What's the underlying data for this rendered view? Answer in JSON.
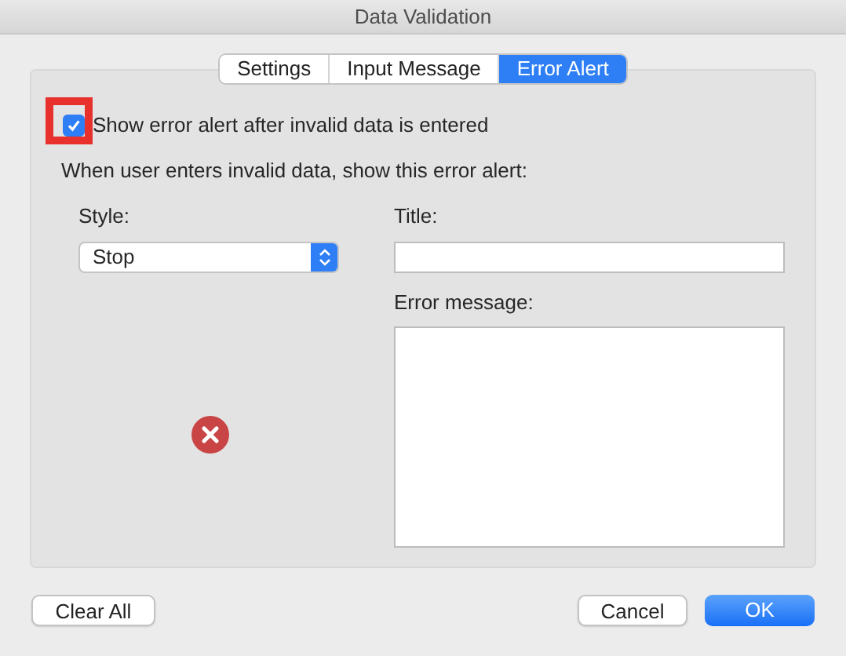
{
  "window": {
    "title": "Data Validation"
  },
  "tabs": [
    {
      "label": "Settings",
      "selected": false
    },
    {
      "label": "Input Message",
      "selected": false
    },
    {
      "label": "Error Alert",
      "selected": true
    }
  ],
  "show_alert": {
    "label": "Show error alert after invalid data is entered",
    "checked": true,
    "highlighted": true
  },
  "instruction": "When user enters invalid data, show this error alert:",
  "style": {
    "label": "Style:",
    "value": "Stop",
    "kind": "stop"
  },
  "title_field": {
    "label": "Title:"
  },
  "message_field": {
    "label": "Error message:"
  },
  "buttons": [
    {
      "label": "Clear All",
      "kind": "secondary"
    },
    {
      "label": "Cancel",
      "kind": "secondary"
    },
    {
      "label": "OK",
      "kind": "primary"
    }
  ]
}
